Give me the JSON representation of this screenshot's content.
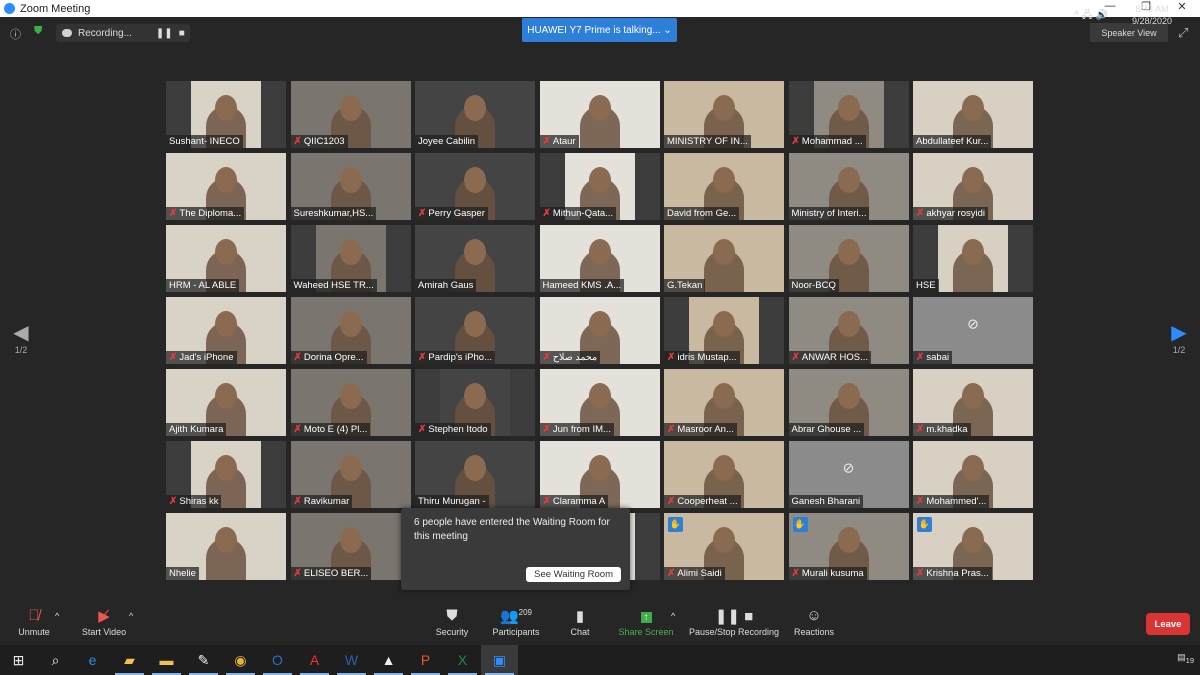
{
  "window": {
    "title": "Zoom Meeting",
    "controls": [
      "—",
      "❐",
      "✕"
    ]
  },
  "topbar": {
    "recording_label": "Recording...",
    "talking_banner": "HUAWEI Y7 Prime is talking...",
    "view_label": "Speaker View"
  },
  "pager": {
    "left": "1/2",
    "right": "1/2"
  },
  "accent": "#2d8cff",
  "tiles": [
    {
      "name": "Sushant- INECO",
      "muted": false
    },
    {
      "name": "QIIC1203",
      "muted": true
    },
    {
      "name": "Joyee Cabilin",
      "muted": false
    },
    {
      "name": "Ataur",
      "muted": true
    },
    {
      "name": "MINISTRY OF IN...",
      "muted": false
    },
    {
      "name": "Mohammad ...",
      "muted": true
    },
    {
      "name": "Abdullateef Kur...",
      "muted": false
    },
    {
      "name": "The Diploma...",
      "muted": true
    },
    {
      "name": "Sureshkumar,HS...",
      "muted": false
    },
    {
      "name": "Perry Gasper",
      "muted": true
    },
    {
      "name": "Mithun-Qata...",
      "muted": true
    },
    {
      "name": "David from Ge...",
      "muted": false
    },
    {
      "name": "Ministry of Interi...",
      "muted": false
    },
    {
      "name": "akhyar rosyidi",
      "muted": true
    },
    {
      "name": "HRM - AL ABLE",
      "muted": false
    },
    {
      "name": "Waheed HSE TR...",
      "muted": false
    },
    {
      "name": "Amirah Gaus",
      "muted": false
    },
    {
      "name": "Hameed KMS .A...",
      "muted": false
    },
    {
      "name": "G.Tekan",
      "muted": false
    },
    {
      "name": "Noor-BCQ",
      "muted": false
    },
    {
      "name": "HSE",
      "muted": false
    },
    {
      "name": "Jad's iPhone",
      "muted": true
    },
    {
      "name": "Dorina Opre...",
      "muted": true
    },
    {
      "name": "Pardip's iPho...",
      "muted": true
    },
    {
      "name": "محمد صلاح",
      "muted": true
    },
    {
      "name": "idris Mustap...",
      "muted": true
    },
    {
      "name": "ANWAR HOS...",
      "muted": true
    },
    {
      "name": "sabai",
      "muted": true,
      "camera_off": true
    },
    {
      "name": "Ajith Kumara",
      "muted": false
    },
    {
      "name": "Moto E (4) Pl...",
      "muted": true
    },
    {
      "name": "Stephen Itodo",
      "muted": true
    },
    {
      "name": "Jun from IM...",
      "muted": true
    },
    {
      "name": "Masroor An...",
      "muted": true
    },
    {
      "name": "Abrar Ghouse ...",
      "muted": false
    },
    {
      "name": "m.khadka",
      "muted": true
    },
    {
      "name": "Shiras kk",
      "muted": true
    },
    {
      "name": "Ravikumar",
      "muted": true
    },
    {
      "name": "Thiru Murugan -",
      "muted": false
    },
    {
      "name": "Claramma A",
      "muted": true
    },
    {
      "name": "Cooperheat ...",
      "muted": true
    },
    {
      "name": "Ganesh Bharani",
      "muted": false,
      "camera_off": true
    },
    {
      "name": "Mohammed'...",
      "muted": true
    },
    {
      "name": "Nhelie",
      "muted": false
    },
    {
      "name": "ELISEO BER...",
      "muted": true
    },
    {
      "name": "",
      "muted": false
    },
    {
      "name": "",
      "muted": false
    },
    {
      "name": "Alimi Saidi",
      "muted": true,
      "hand_raised": true
    },
    {
      "name": "Murali kusuma",
      "muted": true,
      "hand_raised": true
    },
    {
      "name": "Krishna Pras...",
      "muted": true,
      "hand_raised": true
    }
  ],
  "waiting_popup": {
    "message": "6 people have entered the Waiting Room for this meeting",
    "button": "See Waiting Room"
  },
  "toolbar": {
    "unmute": "Unmute",
    "start_video": "Start Video",
    "security": "Security",
    "participants": "Participants",
    "participant_count": "209",
    "chat": "Chat",
    "share_screen": "Share Screen",
    "recording": "Pause/Stop Recording",
    "reactions": "Reactions",
    "leave": "Leave"
  },
  "taskbar": {
    "apps": [
      "start",
      "search",
      "edge",
      "file-explorer-2",
      "file-explorer",
      "paint",
      "chrome",
      "outlook",
      "acrobat",
      "word",
      "photos",
      "powerpoint",
      "excel",
      "zoom"
    ],
    "time": "8:43 AM",
    "date": "9/28/2020",
    "notifications": "19"
  }
}
